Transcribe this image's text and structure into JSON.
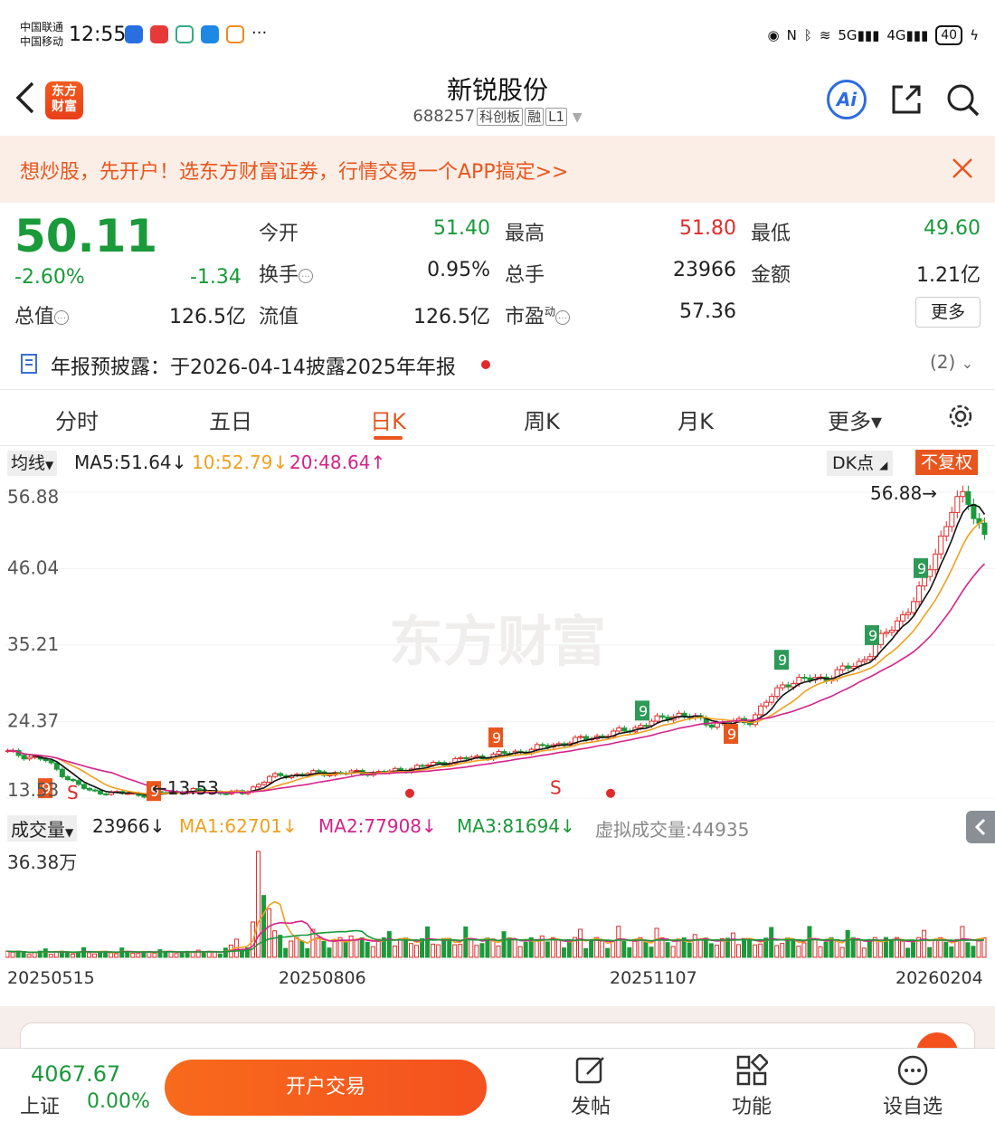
{
  "status_bar": {
    "carrier1": "中国联通",
    "carrier2": "中国移动",
    "time": "12:55",
    "more": "···",
    "network1": "5G",
    "network2": "4G",
    "battery": "40"
  },
  "header": {
    "logo_line1": "东方",
    "logo_line2": "财富",
    "title": "新锐股份",
    "code": "688257",
    "tag1": "科创板",
    "tag2": "融",
    "tag3": "L1",
    "ai_label": "Ai"
  },
  "banner": {
    "text": "想炒股，先开户！选东方财富证券，行情交易一个APP搞定>>"
  },
  "quote": {
    "price": "50.11",
    "pct": "-2.60%",
    "change": "-1.34",
    "open_label": "今开",
    "open": "51.40",
    "high_label": "最高",
    "high": "51.80",
    "low_label": "最低",
    "low": "49.60",
    "turnover_label": "换手",
    "turnover": "0.95%",
    "volume_label": "总手",
    "volume": "23966",
    "amount_label": "金额",
    "amount": "1.21亿",
    "mktcap_label": "总值",
    "mktcap": "126.5亿",
    "float_label": "流值",
    "float": "126.5亿",
    "pe_label": "市盈",
    "pe_sup": "动",
    "pe": "57.36",
    "more_label": "更多"
  },
  "report": {
    "text": "年报预披露：于2026-04-14披露2025年年报",
    "count": "(2)"
  },
  "tabs": [
    {
      "label": "分时"
    },
    {
      "label": "五日"
    },
    {
      "label": "日K"
    },
    {
      "label": "周K"
    },
    {
      "label": "月K"
    },
    {
      "label": "更多▾"
    }
  ],
  "ma_bar": {
    "type": "均线",
    "ma5": "MA5:51.64↓",
    "ma10": "10:52.79↓",
    "ma20": "20:48.64↑",
    "dk": "DK点",
    "fq": "不复权"
  },
  "kline": {
    "y_ticks": [
      "56.88",
      "46.04",
      "35.21",
      "24.37",
      "13.53"
    ],
    "high_mark": "56.88",
    "low_mark": "13.53",
    "watermark": "东方财富",
    "colors": {
      "up": "#e12b2b",
      "down": "#1a9a3a",
      "ma5": "#111111",
      "ma10": "#f0a020",
      "ma20": "#d4238a"
    }
  },
  "volume_bar": {
    "type": "成交量",
    "vol": "23966↓",
    "ma1": "MA1:62701↓",
    "ma2": "MA2:77908↓",
    "ma3": "MA3:81694↓",
    "virtual": "虚拟成交量:44935",
    "y_max": "36.38万"
  },
  "dates": [
    "20250515",
    "20250806",
    "20251107",
    "20260204"
  ],
  "bottom": {
    "index_value": "4067.67",
    "index_name": "上证",
    "index_pct": "0.00%",
    "trade": "开户交易",
    "post": "发帖",
    "func": "功能",
    "watch": "设自选"
  }
}
